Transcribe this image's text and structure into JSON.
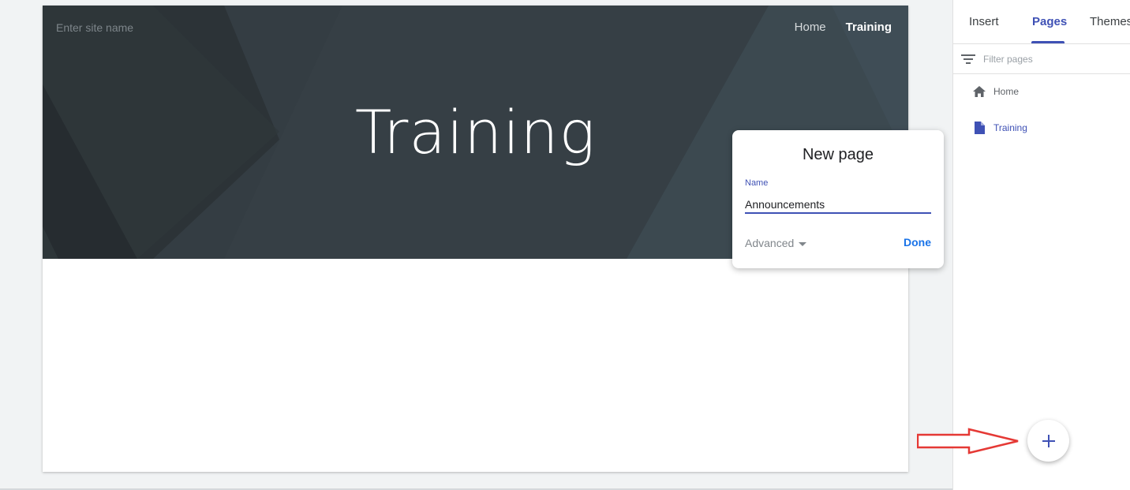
{
  "canvas": {
    "site_name_placeholder": "Enter site name",
    "nav": {
      "home": "Home",
      "training": "Training"
    },
    "hero_title": "Training"
  },
  "dialog": {
    "title": "New page",
    "field_label": "Name",
    "field_value": "Announcements",
    "advanced_label": "Advanced",
    "done_label": "Done"
  },
  "panel": {
    "tabs": {
      "insert": "Insert",
      "pages": "Pages",
      "themes": "Themes"
    },
    "filter_placeholder": "Filter pages",
    "pages": [
      {
        "label": "Home",
        "icon": "home-icon"
      },
      {
        "label": "Training",
        "icon": "page-icon"
      }
    ]
  },
  "fab": {
    "icon": "plus-icon"
  },
  "colors": {
    "accent": "#3f51b5",
    "header_bg": "#343d43",
    "done": "#1a73e8",
    "arrow": "#e53935"
  }
}
